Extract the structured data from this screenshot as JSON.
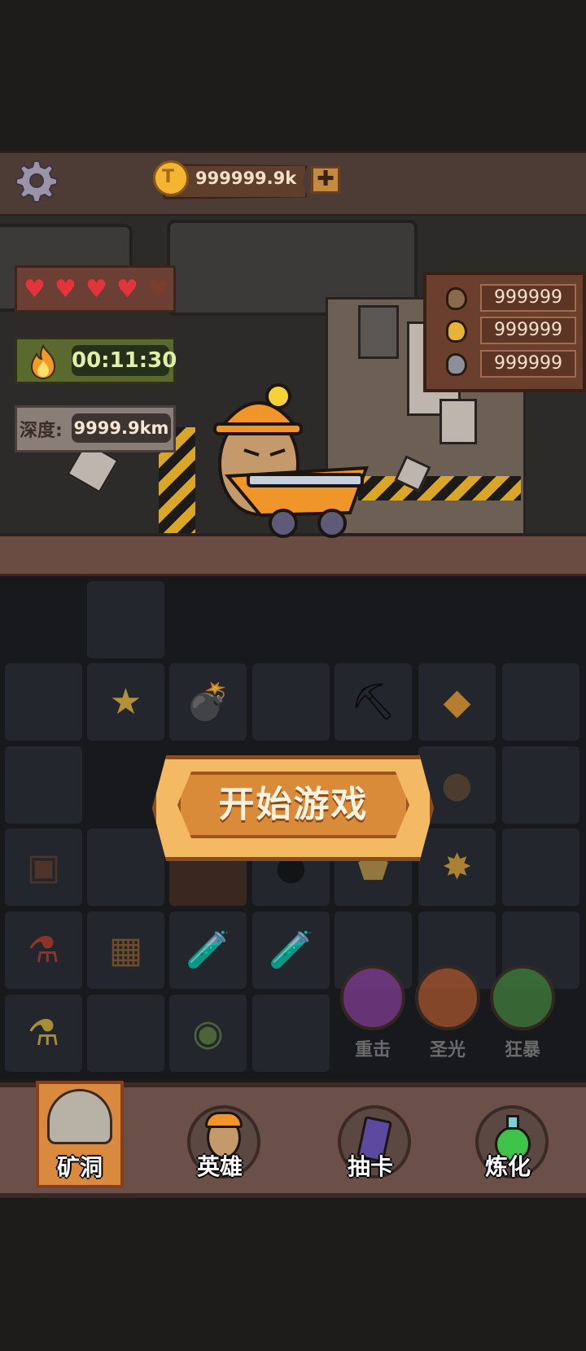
{
  "top_bar": {
    "coins": "999999.9k",
    "add_symbol": "✚"
  },
  "stats": {
    "hearts_full": 4,
    "hearts_total": 5,
    "timer": "00:11:30",
    "depth_label": "深度:",
    "depth_value": "9999.9km"
  },
  "resources": [
    {
      "name": "stone-ore",
      "value": "999999",
      "color": "#8a6a4a"
    },
    {
      "name": "gold-ore",
      "value": "999999",
      "color": "#e7b23a"
    },
    {
      "name": "iron-ore",
      "value": "999999",
      "color": "#8b9098"
    }
  ],
  "start_button": {
    "label": "开始游戏"
  },
  "skills": [
    {
      "label": "重击",
      "color": "#7a3a8c",
      "icon": "fist-icon"
    },
    {
      "label": "圣光",
      "color": "#a0522d",
      "icon": "sword-icon"
    },
    {
      "label": "狂暴",
      "color": "#3f7a3a",
      "icon": "leaf-icon"
    }
  ],
  "nav": [
    {
      "label": "矿洞",
      "icon": "mine-icon",
      "active": true
    },
    {
      "label": "英雄",
      "icon": "hero-icon",
      "active": false
    },
    {
      "label": "抽卡",
      "icon": "card-icon",
      "active": false
    },
    {
      "label": "炼化",
      "icon": "potion-icon",
      "active": false
    }
  ]
}
